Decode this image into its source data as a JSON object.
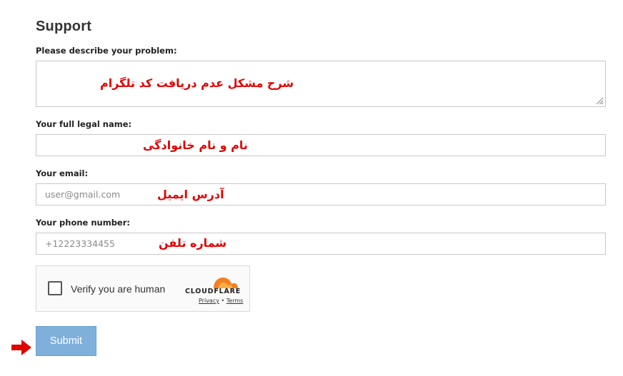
{
  "page": {
    "title": "Support"
  },
  "form": {
    "problem": {
      "label": "Please describe your problem:",
      "value": "",
      "note": "شرح مشکل عدم دریافت کد تلگرام"
    },
    "name": {
      "label": "Your full legal name:",
      "value": "",
      "note": "نام و نام خانوادگی"
    },
    "email": {
      "label": "Your email:",
      "placeholder": "user@gmail.com",
      "note": "آدرس ایمیل"
    },
    "phone": {
      "label": "Your phone number:",
      "placeholder": "+12223334455",
      "note": "شماره تلفن"
    },
    "submit_label": "Submit"
  },
  "captcha": {
    "label": "Verify you are human",
    "brand": "CLOUDFLARE",
    "privacy_label": "Privacy",
    "separator": " • ",
    "terms_label": "Terms",
    "logo_icon": "cloudflare-logo-icon",
    "checked": false
  },
  "colors": {
    "annotation": "#e00000",
    "submit_bg": "#7fb0dc",
    "cloudflare_orange": "#f38020"
  },
  "icons": {
    "arrow": "red-arrow-right-icon",
    "resize": "resize-handle-icon"
  }
}
